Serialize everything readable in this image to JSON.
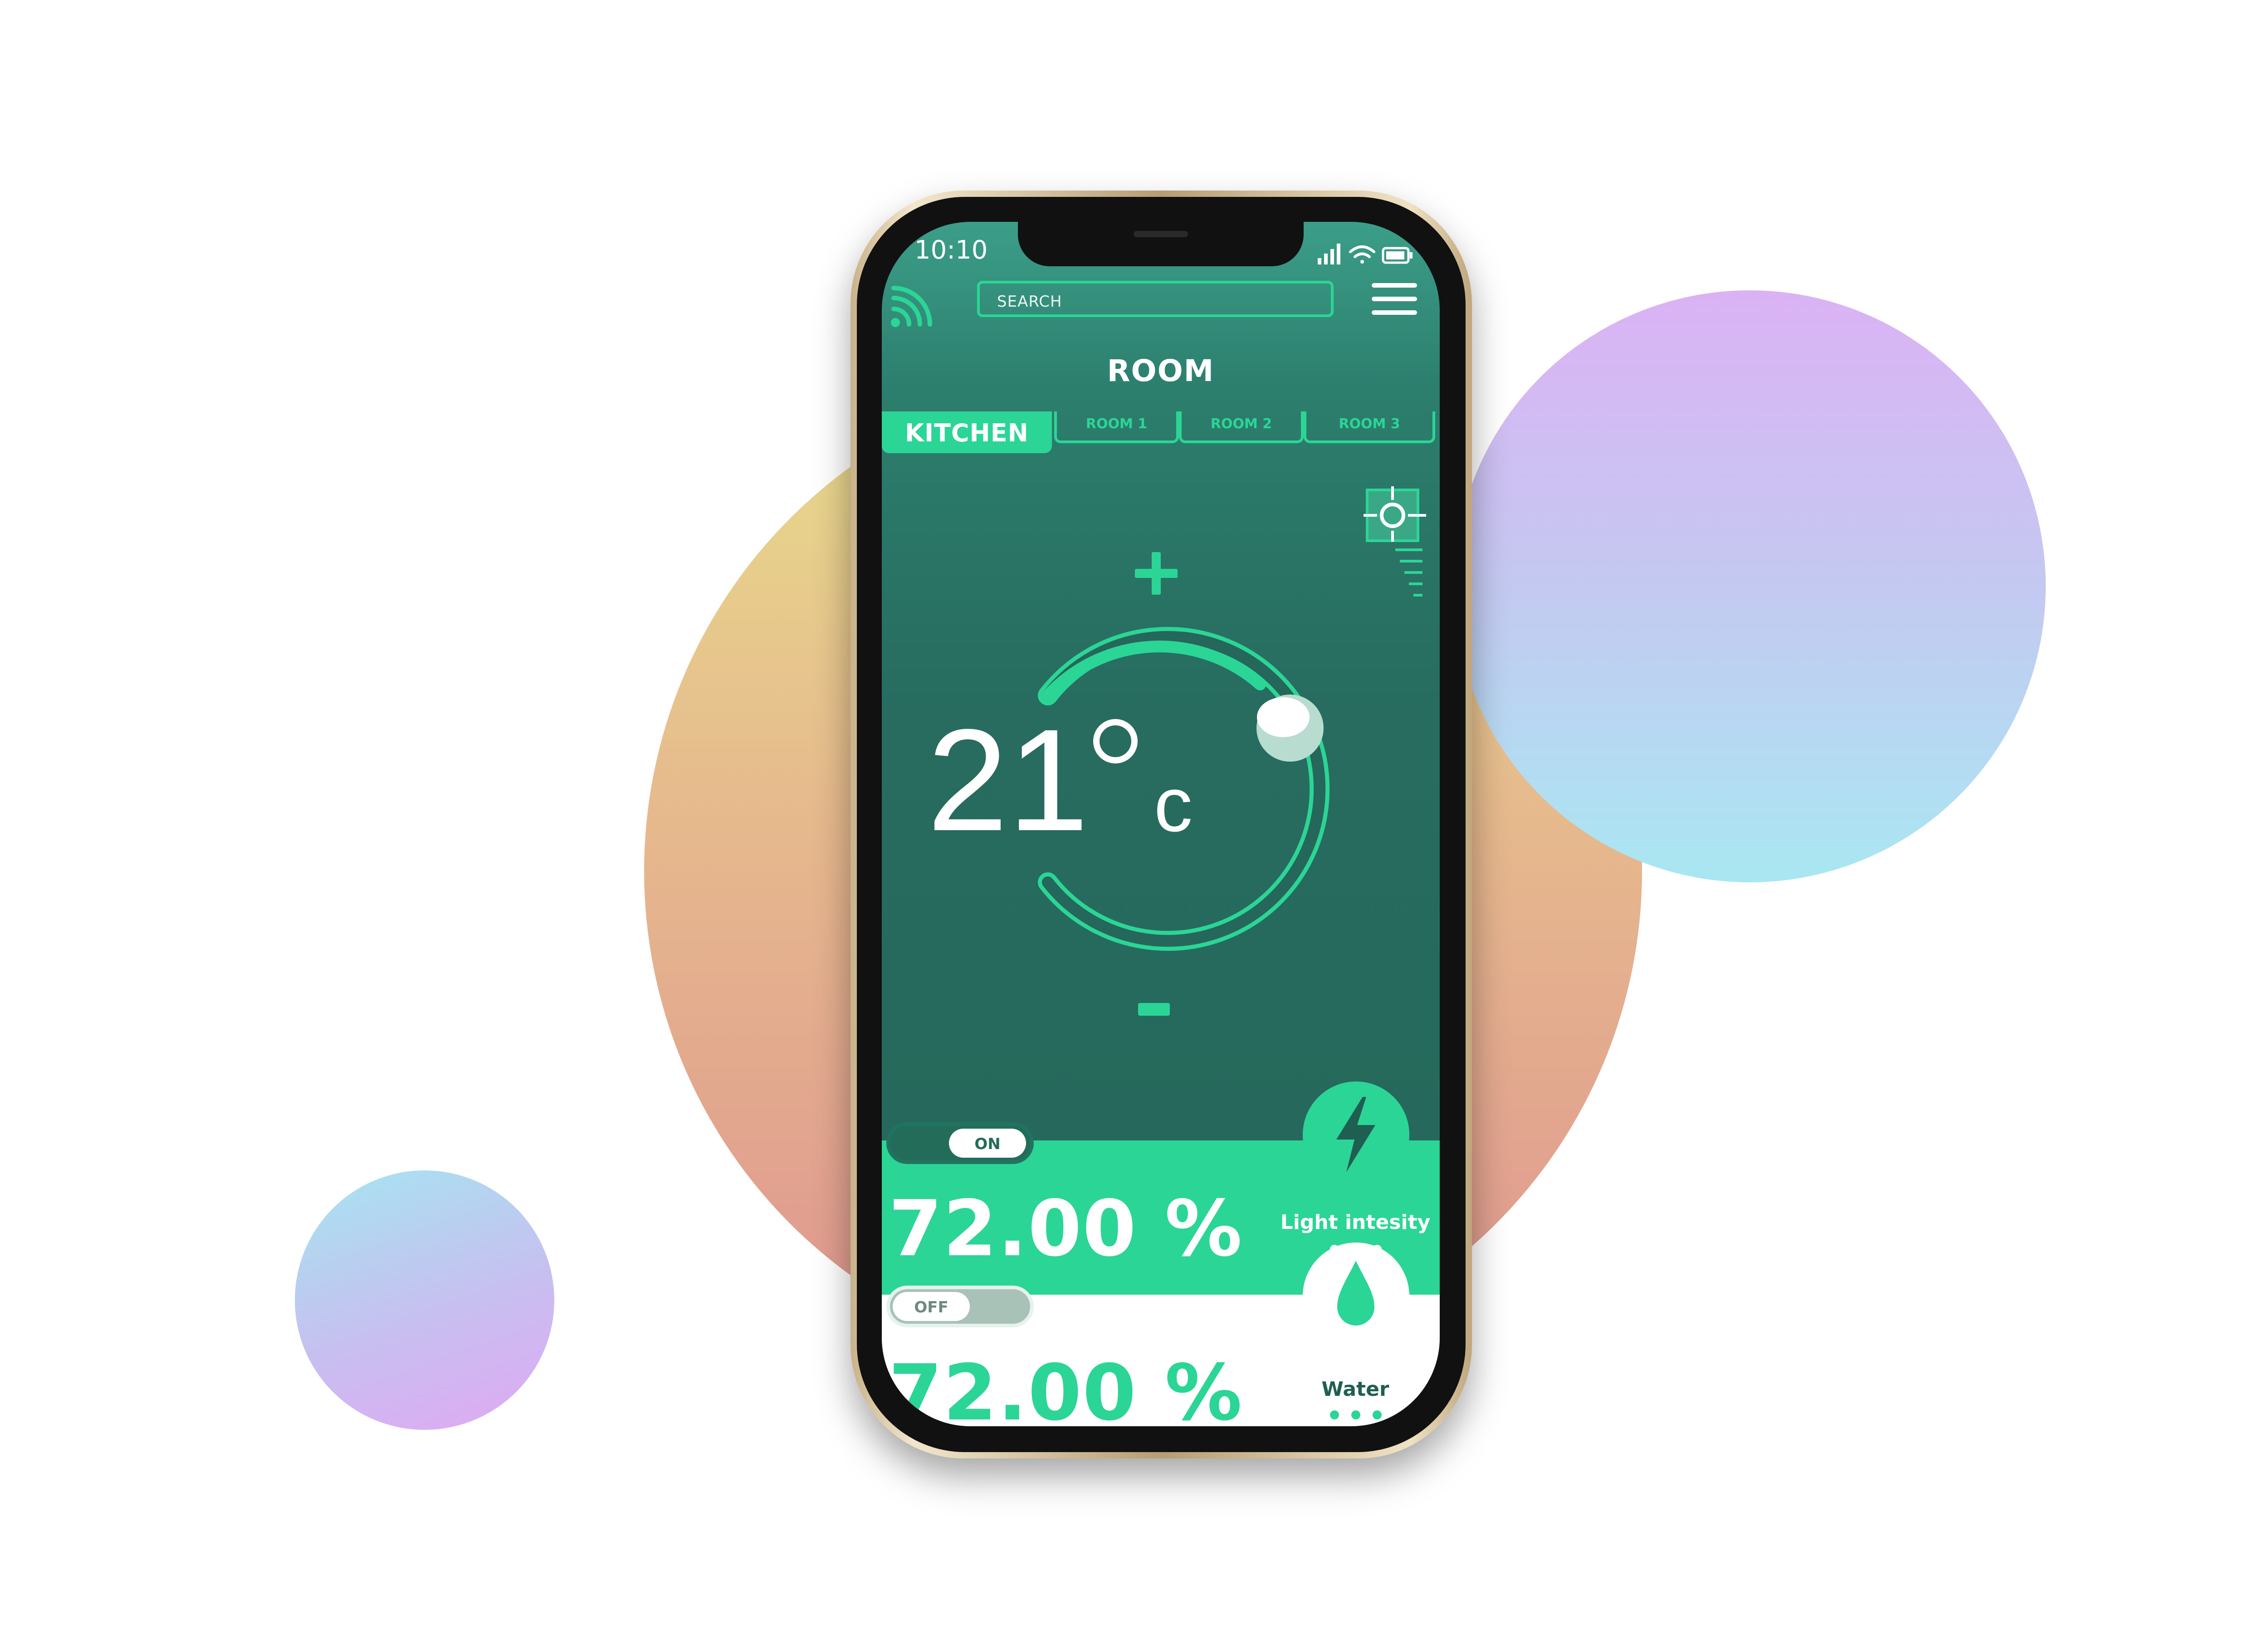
{
  "status_bar": {
    "time": "10:10"
  },
  "header": {
    "search_placeholder": "SEARCH",
    "title": "ROOM"
  },
  "tabs": [
    {
      "label": "KITCHEN",
      "active": true
    },
    {
      "label": "ROOM 1",
      "active": false
    },
    {
      "label": "ROOM 2",
      "active": false
    },
    {
      "label": "ROOM 3",
      "active": false
    }
  ],
  "thermostat": {
    "value": "21",
    "unit": "c"
  },
  "light": {
    "toggle_label": "ON",
    "value": "72.00 %",
    "label": "Light intesity",
    "icon": "lightning-icon"
  },
  "water": {
    "toggle_label": "OFF",
    "value": "72.00 %",
    "label": "Water",
    "icon": "water-drop-icon"
  },
  "colors": {
    "accent": "#2bd596",
    "screen_bg": "#276c5f",
    "dark_accent": "#1f5f52"
  }
}
